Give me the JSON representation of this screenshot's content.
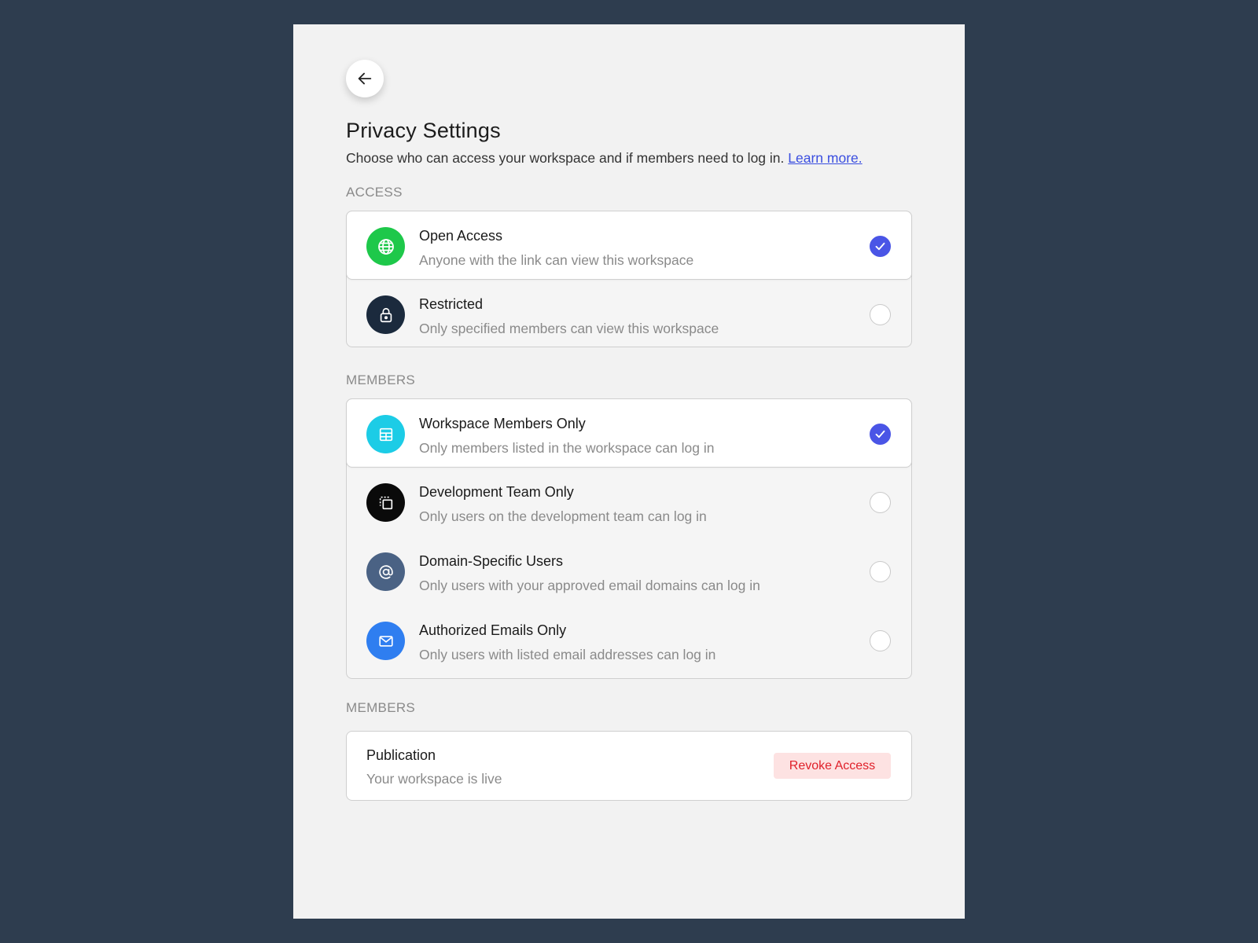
{
  "page": {
    "title": "Privacy Settings",
    "subtitle": "Choose who can access your workspace and if members need to log in.",
    "learn_more": "Learn more."
  },
  "access": {
    "label": "ACCESS",
    "options": [
      {
        "title": "Open Access",
        "description": "Anyone with the link can view this workspace",
        "icon": "globe-icon",
        "icon_color": "#1ec84a",
        "selected": true
      },
      {
        "title": "Restricted",
        "description": "Only specified members can view this workspace",
        "icon": "lock-icon",
        "icon_color": "#1b2a3d",
        "selected": false
      }
    ]
  },
  "members": {
    "label": "MEMBERS",
    "options": [
      {
        "title": "Workspace Members Only",
        "description": "Only members listed in the workspace can log in",
        "icon": "table-icon",
        "icon_color": "#1ccce6",
        "selected": true
      },
      {
        "title": "Development Team Only",
        "description": "Only users on the development team can log in",
        "icon": "copy-icon",
        "icon_color": "#0a0a0a",
        "selected": false
      },
      {
        "title": "Domain-Specific Users",
        "description": "Only users with your approved email domains can log in",
        "icon": "at-icon",
        "icon_color": "#4a6284",
        "selected": false
      },
      {
        "title": "Authorized Emails Only",
        "description": "Only users with listed email addresses can log in",
        "icon": "mail-icon",
        "icon_color": "#2f7ef0",
        "selected": false
      }
    ]
  },
  "publication_section": {
    "label": "MEMBERS",
    "title": "Publication",
    "description": "Your workspace is live",
    "revoke_label": "Revoke Access"
  },
  "colors": {
    "accent": "#4a55e6",
    "danger": "#e0202a",
    "background": "#2e3d4f"
  }
}
